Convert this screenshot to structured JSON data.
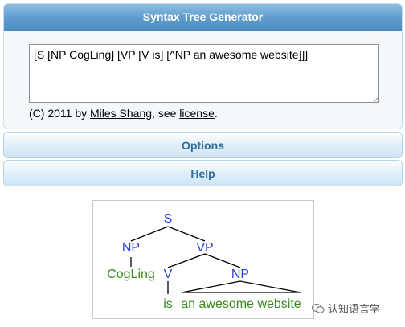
{
  "generator": {
    "title": "Syntax Tree Generator",
    "input_value": "[S [NP CogLing] [VP [V is] [^NP an awesome website]]]",
    "credit_prefix": "(C) 2011 by ",
    "author_link": "Miles Shang",
    "credit_middle": ", see ",
    "license_link": "license",
    "credit_suffix": "."
  },
  "options_label": "Options",
  "help_label": "Help",
  "tree": {
    "s": "S",
    "np1": "NP",
    "vp": "VP",
    "cogling": "CogLing",
    "v": "V",
    "np2": "NP",
    "is": "is",
    "phrase": "an awesome website"
  },
  "watermark": "认知语言学",
  "colors": {
    "header_blue": "#5f9ccd",
    "nonterminal_blue": "#2b3fd6",
    "leaf_green": "#3a8a1f"
  }
}
